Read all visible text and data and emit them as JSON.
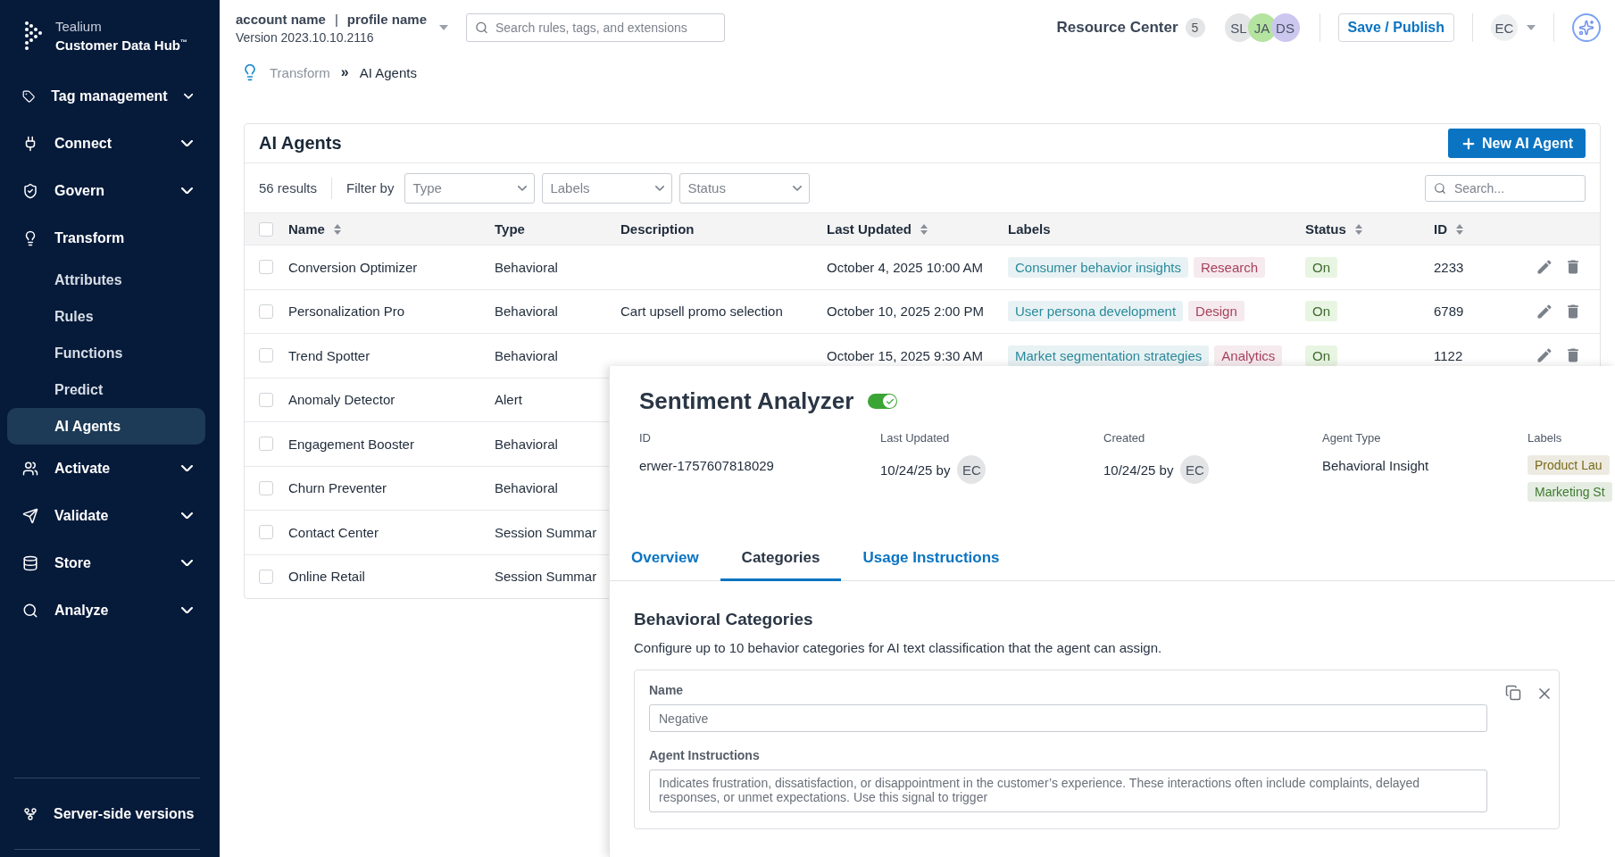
{
  "brand": {
    "company": "Tealium",
    "product": "Customer Data Hub$^{™}$"
  },
  "sidebar": {
    "items": [
      {
        "label": "Tag management",
        "expanded": false
      },
      {
        "label": "Connect",
        "expanded": false
      },
      {
        "label": "Govern",
        "expanded": false
      },
      {
        "label": "Transform",
        "expanded": true,
        "children": [
          {
            "label": "Attributes",
            "selected": false
          },
          {
            "label": "Rules",
            "selected": false
          },
          {
            "label": "Functions",
            "selected": false
          },
          {
            "label": "Predict",
            "selected": false
          },
          {
            "label": "AI Agents",
            "selected": true
          }
        ]
      },
      {
        "label": "Activate",
        "expanded": false
      },
      {
        "label": "Validate",
        "expanded": false
      },
      {
        "label": "Store",
        "expanded": false
      },
      {
        "label": "Analyze",
        "expanded": false
      }
    ],
    "footer": "Server-side versions"
  },
  "header": {
    "account": "account name",
    "separator": "|",
    "profile": "profile name",
    "version": "Version 2023.10.10.2116",
    "search": {
      "placeholder": "Search rules, tags, and extensions"
    },
    "resource_center": "Resource Center",
    "resource_count": "5",
    "collaborators": [
      {
        "initials": "SL",
        "color": "#e4e5e7"
      },
      {
        "initials": "JA",
        "color": "#b5e3a0"
      },
      {
        "initials": "DS",
        "color": "#cbc7ef"
      }
    ],
    "save_button": "Save / Publish",
    "user": "EC"
  },
  "breadcrumb": [
    "Transform",
    "»",
    "AI Agents"
  ],
  "table_card": {
    "title": "AI Agents",
    "new_button": "New AI Agent",
    "results": "56 results",
    "filter_label": "Filter by",
    "filters": [
      {
        "placeholder": "Type"
      },
      {
        "placeholder": "Labels"
      },
      {
        "placeholder": "Status"
      }
    ],
    "search": {
      "placeholder": "Search..."
    },
    "header_checked": false,
    "columns": [
      {
        "label": "Name",
        "sortable": true
      },
      {
        "label": "Type",
        "sortable": false
      },
      {
        "label": "Description",
        "sortable": false
      },
      {
        "label": "Last Updated",
        "sortable": true
      },
      {
        "label": "Labels",
        "sortable": false
      },
      {
        "label": "Status",
        "sortable": true
      },
      {
        "label": "ID",
        "sortable": true
      }
    ],
    "rows": [
      {
        "checked": false,
        "name": "Conversion Optimizer",
        "type": "Behavioral",
        "updated": "October 4, 2025 10:00 AM",
        "labels": [
          {
            "text": "Consumer behavior insights",
            "color": "#2a8a9c"
          },
          {
            "text": "Research",
            "color": "#a8405e"
          }
        ],
        "status": "On",
        "id": "2233"
      },
      {
        "checked": false,
        "name": "Personalization Pro",
        "type": "Behavioral",
        "description": "Cart upsell promo selection",
        "updated": "October 10, 2025 2:00 PM",
        "labels": [
          {
            "text": "User persona development",
            "color": "#2a8a9c"
          },
          {
            "text": "Design",
            "color": "#a8405e"
          }
        ],
        "status": "On",
        "id": "6789"
      },
      {
        "checked": false,
        "name": "Trend Spotter",
        "type": "Behavioral",
        "updated": "October 15, 2025 9:30 AM",
        "labels": [
          {
            "text": "Market segmentation strategies",
            "color": "#2a8a9c"
          },
          {
            "text": "Analytics",
            "color": "#a8405e"
          }
        ],
        "status": "On",
        "id": "1122"
      },
      {
        "checked": false,
        "name": "Anomaly Detector",
        "type": "Alert"
      },
      {
        "checked": false,
        "name": "Engagement Booster",
        "type": "Behavioral"
      },
      {
        "checked": false,
        "name": "Churn Preventer",
        "type": "Behavioral"
      },
      {
        "checked": false,
        "name": "Contact Center",
        "type": "Session Summar"
      },
      {
        "checked": false,
        "name": "Online Retail",
        "type": "Session Summar"
      }
    ]
  },
  "detail_panel": {
    "title": "Sentiment Analyzer",
    "enabled": true,
    "meta": [
      {
        "label": "ID",
        "value": "erwer-1757607818029"
      },
      {
        "label": "Last Updated",
        "value": "10/24/25 by",
        "avatar": "EC"
      },
      {
        "label": "Created",
        "value": "10/24/25 by",
        "avatar": "EC"
      },
      {
        "label": "Agent Type",
        "value": "Behavioral Insight"
      }
    ],
    "labels_heading": "Labels",
    "labels": [
      {
        "text": "Product Lau",
        "color": "#7a6a1c"
      },
      {
        "text": "Marketing St",
        "color": "#3f7a2e"
      }
    ],
    "tabs": [
      {
        "label": "Overview",
        "selected": false
      },
      {
        "label": "Categories",
        "selected": true
      },
      {
        "label": "Usage Instructions",
        "selected": false
      }
    ],
    "section_title": "Behavioral Categories",
    "section_text": "Configure up to 10 behavior categories for AI text classification that the agent can assign.",
    "category": {
      "name_label": "Name",
      "name_value": "Negative",
      "instructions_label": "Agent Instructions",
      "instructions_value": "Indicates frustration, dissatisfaction, or disappointment in the customer’s experience. These interactions often include complaints, delayed responses, or unmet expectations. Use this signal to trigger"
    }
  }
}
